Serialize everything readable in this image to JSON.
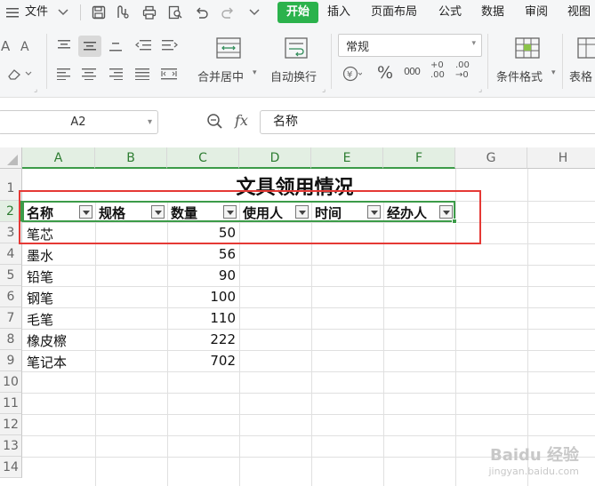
{
  "menubar": {
    "file_label": "文件",
    "tabs": [
      "开始",
      "插入",
      "页面布局",
      "公式",
      "数据",
      "审阅",
      "视图"
    ],
    "active_tab": "开始"
  },
  "ribbon": {
    "merge_label": "合并居中",
    "wrap_label": "自动换行",
    "number_format": "常规",
    "currency_symbol": "¥",
    "percent_symbol": "%",
    "thousands_symbol": "000",
    "dec_increase": "+0 .00",
    "dec_decrease": ".00 →0",
    "conditional_label": "条件格式",
    "table_label": "表格"
  },
  "formula_bar": {
    "cell_ref": "A2",
    "fx": "fx",
    "content": "名称"
  },
  "columns": [
    "A",
    "B",
    "C",
    "D",
    "E",
    "F",
    "G",
    "H"
  ],
  "rows": [
    "1",
    "2",
    "3",
    "4",
    "5",
    "6",
    "7",
    "8",
    "9",
    "10",
    "11",
    "12",
    "13",
    "14"
  ],
  "sheet": {
    "title": "文具领用情况",
    "headers": [
      "名称",
      "规格",
      "数量",
      "使用人",
      "时间",
      "经办人"
    ],
    "items": [
      {
        "name": "笔芯",
        "qty": "50"
      },
      {
        "name": "墨水",
        "qty": "56"
      },
      {
        "name": "铅笔",
        "qty": "90"
      },
      {
        "name": "钢笔",
        "qty": "100"
      },
      {
        "name": "毛笔",
        "qty": "110"
      },
      {
        "name": "橡皮檫",
        "qty": "222"
      },
      {
        "name": "笔记本",
        "qty": "702"
      }
    ]
  },
  "watermark": {
    "text": "Baidu 经验",
    "sub": "jingyan.baidu.com"
  },
  "colors": {
    "accent": "#2bb24c",
    "selection": "#3c9b48",
    "highlight_box": "#e53935"
  }
}
